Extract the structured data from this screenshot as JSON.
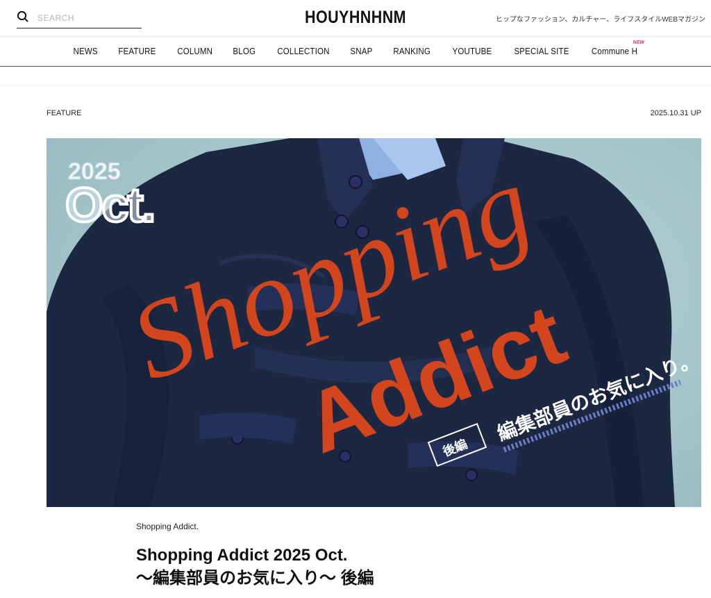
{
  "header": {
    "search_placeholder": "SEARCH",
    "logo": "HOUYHNHNM",
    "tagline": "ヒップなファッション、カルチャー、ライフスタイルWEBマガジン"
  },
  "nav": {
    "items": [
      {
        "label": "NEWS"
      },
      {
        "label": "FEATURE"
      },
      {
        "label": "COLUMN"
      },
      {
        "label": "BLOG"
      },
      {
        "label": "COLLECTION"
      },
      {
        "label": "SNAP"
      },
      {
        "label": "RANKING"
      },
      {
        "label": "YOUTUBE"
      },
      {
        "label": "SPECIAL SITE"
      },
      {
        "label": "Commune H",
        "badge": "NEW"
      }
    ],
    "badge_color": "#e8336f"
  },
  "article": {
    "category": "FEATURE",
    "date": "2025.10.31 UP",
    "hero": {
      "year": "2025",
      "month": "Oct.",
      "script_word": "Shopping",
      "block_word": "Addict",
      "part_tag": "後編",
      "subtitle": "編集部員のお気に入り。",
      "accent_color": "#d2451d",
      "jacket_color": "#1c2742",
      "background_color": "#a9c8cd"
    },
    "kicker": "Shopping Addict.",
    "title_line1": "Shopping Addict 2025 Oct.",
    "title_line2": "〜編集部員のお気に入り〜 後編"
  }
}
